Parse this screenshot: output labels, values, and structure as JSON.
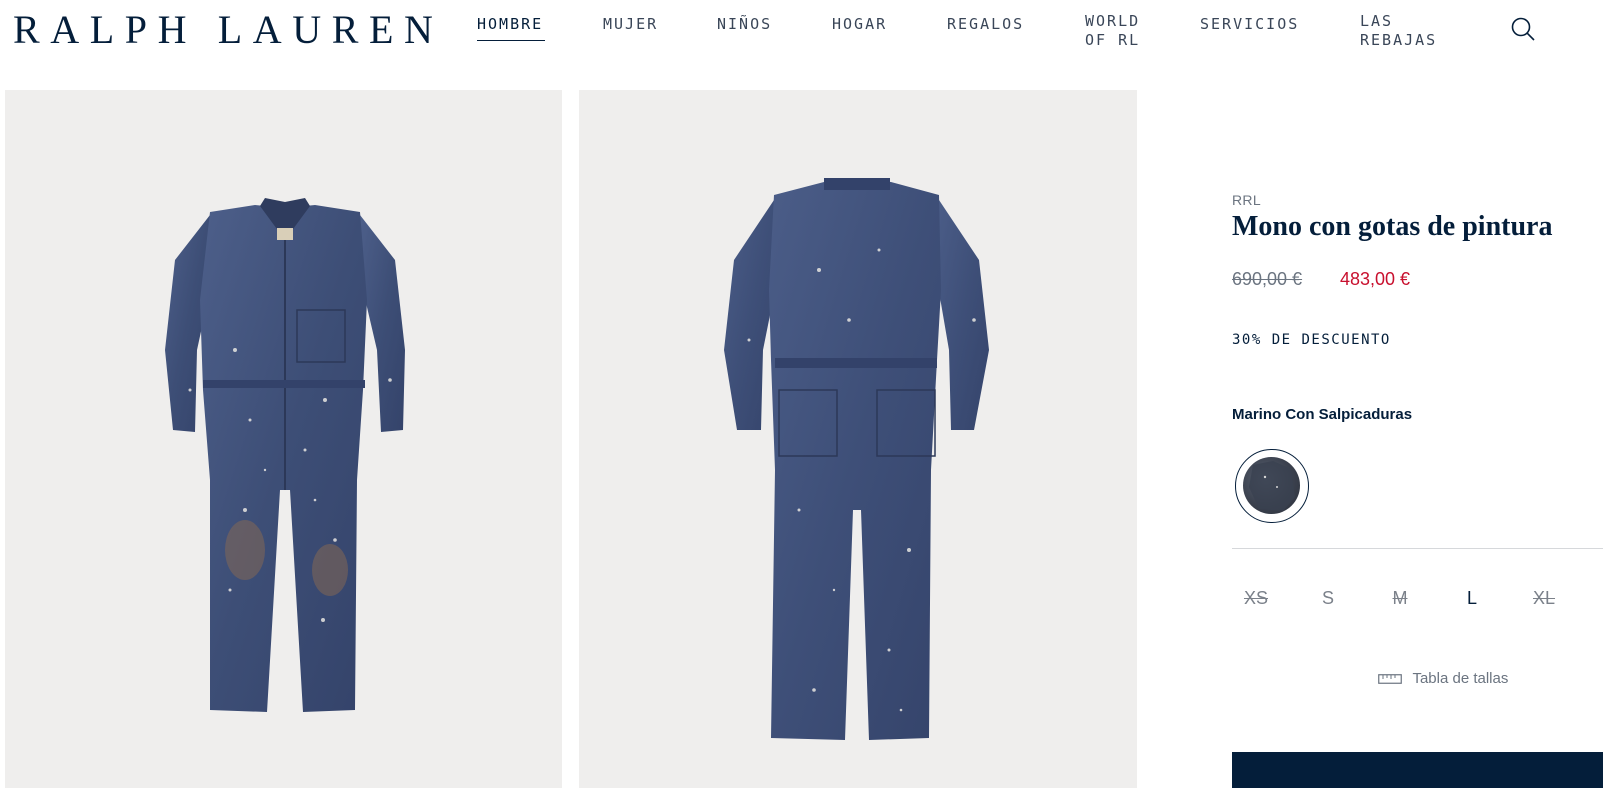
{
  "header": {
    "logo": "RALPH LAUREN",
    "nav": [
      {
        "line1": "HOMBRE",
        "line2": ""
      },
      {
        "line1": "MUJER",
        "line2": ""
      },
      {
        "line1": "NIÑOS",
        "line2": ""
      },
      {
        "line1": "HOGAR",
        "line2": ""
      },
      {
        "line1": "REGALOS",
        "line2": ""
      },
      {
        "line1": "WORLD",
        "line2": "OF RL"
      },
      {
        "line1": "SERVICIOS",
        "line2": ""
      },
      {
        "line1": "LAS",
        "line2": "REBAJAS"
      }
    ],
    "search_icon": "search-icon"
  },
  "product": {
    "brand": "RRL",
    "title": "Mono con gotas de pintura",
    "price_original": "690,00 €",
    "price_sale": "483,00 €",
    "discount": "30% DE DESCUENTO",
    "color_name": "Marino Con Salpicaduras",
    "sizes": [
      {
        "label": "XS",
        "available": false
      },
      {
        "label": "S",
        "available": true
      },
      {
        "label": "M",
        "available": false
      },
      {
        "label": "L",
        "available": true
      },
      {
        "label": "XL",
        "available": false
      }
    ],
    "size_guide": "Tabla de tallas"
  },
  "colors": {
    "navy": "#041e3a",
    "sale_red": "#c8102e",
    "photo_bg": "#efeeed",
    "denim": "#3f5078"
  }
}
